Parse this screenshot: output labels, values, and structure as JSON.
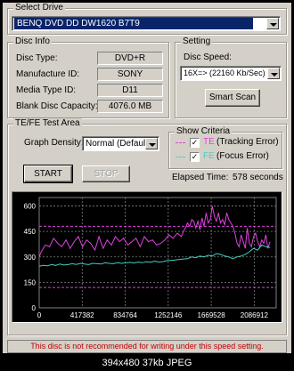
{
  "select_drive": {
    "title": "Select Drive",
    "drive": "BENQ    DVD DD DW1620   B7T9"
  },
  "disc_info": {
    "title": "Disc Info",
    "rows": [
      {
        "label": "Disc Type:",
        "value": "DVD+R"
      },
      {
        "label": "Manufacture ID:",
        "value": "SONY"
      },
      {
        "label": "Media Type ID:",
        "value": "D11"
      },
      {
        "label": "Blank Disc Capacity:",
        "value": "4076.0 MB"
      }
    ]
  },
  "setting": {
    "title": "Setting",
    "speed_label": "Disc Speed:",
    "speed_value": "16X=> (22160 Kb/Sec)",
    "smart_scan": "Smart Scan"
  },
  "tefe": {
    "title": "TE/FE Test Area",
    "density_label": "Graph Density:",
    "density_value": "Normal (Default)",
    "start": "START",
    "stop": "STOP",
    "elapsed_label": "Elapsed Time:",
    "elapsed_value": "578 seconds"
  },
  "criteria": {
    "title": "Show Criteria",
    "te": {
      "abbr": "TE",
      "text": "(Tracking Error)",
      "checked": true,
      "color": "#e040e0"
    },
    "fe": {
      "abbr": "FE",
      "text": "(Focus Error)",
      "checked": true,
      "color": "#40d0c0"
    }
  },
  "status_text": "This disc is not recommended for writing under this speed setting.",
  "caption": "394x480  37kb  JPEG",
  "chart_data": {
    "type": "line",
    "ylim": [
      0,
      650
    ],
    "yticks": [
      0,
      150,
      300,
      450,
      600
    ],
    "xlim": [
      0,
      2300000
    ],
    "xticks": [
      "0",
      "417382",
      "834764",
      "1252146",
      "1669528",
      "2086912"
    ],
    "xtick_values": [
      0,
      417382,
      834764,
      1252146,
      1669528,
      2086912
    ],
    "threshold_high": 480,
    "threshold_low": 120,
    "threshold_color": "#e040e0",
    "grid_color": "#808080",
    "series": [
      {
        "name": "TE",
        "color": "#e040e0",
        "x": [
          0,
          20000,
          60000,
          100000,
          140000,
          180000,
          220000,
          260000,
          300000,
          340000,
          380000,
          420000,
          460000,
          500000,
          540000,
          580000,
          620000,
          660000,
          700000,
          740000,
          780000,
          820000,
          860000,
          900000,
          940000,
          980000,
          1020000,
          1060000,
          1100000,
          1140000,
          1180000,
          1220000,
          1260000,
          1300000,
          1340000,
          1380000,
          1400000,
          1420000,
          1440000,
          1460000,
          1480000,
          1500000,
          1520000,
          1540000,
          1560000,
          1580000,
          1600000,
          1620000,
          1640000,
          1660000,
          1680000,
          1700000,
          1720000,
          1740000,
          1760000,
          1780000,
          1800000,
          1820000,
          1840000,
          1860000,
          1880000,
          1900000,
          1920000,
          1940000,
          1960000,
          1980000,
          2000000,
          2020000,
          2040000,
          2060000,
          2080000,
          2100000,
          2120000,
          2140000,
          2160000,
          2180000,
          2200000,
          2220000,
          2240000
        ],
        "y": [
          300,
          330,
          370,
          360,
          410,
          380,
          360,
          400,
          350,
          390,
          420,
          360,
          400,
          380,
          340,
          420,
          350,
          400,
          370,
          420,
          390,
          410,
          370,
          390,
          410,
          360,
          420,
          390,
          400,
          370,
          380,
          400,
          430,
          410,
          440,
          420,
          450,
          470,
          500,
          480,
          520,
          510,
          470,
          510,
          460,
          530,
          480,
          560,
          500,
          520,
          600,
          540,
          510,
          560,
          500,
          520,
          490,
          560,
          520,
          500,
          480,
          440,
          380,
          360,
          430,
          390,
          350,
          470,
          380,
          360,
          420,
          440,
          390,
          360,
          400,
          380,
          430,
          350,
          390
        ]
      },
      {
        "name": "FE",
        "color": "#40d0c0",
        "x": [
          0,
          40000,
          80000,
          120000,
          160000,
          200000,
          240000,
          280000,
          320000,
          360000,
          400000,
          440000,
          480000,
          520000,
          560000,
          600000,
          640000,
          680000,
          720000,
          760000,
          800000,
          840000,
          880000,
          920000,
          960000,
          1000000,
          1040000,
          1080000,
          1120000,
          1160000,
          1200000,
          1240000,
          1280000,
          1320000,
          1360000,
          1400000,
          1440000,
          1480000,
          1520000,
          1560000,
          1600000,
          1640000,
          1680000,
          1720000,
          1760000,
          1800000,
          1840000,
          1880000,
          1920000,
          1960000,
          2000000,
          2040000,
          2080000,
          2120000,
          2160000,
          2200000,
          2240000
        ],
        "y": [
          245,
          250,
          248,
          255,
          250,
          258,
          252,
          255,
          260,
          256,
          262,
          258,
          255,
          262,
          260,
          258,
          265,
          262,
          260,
          266,
          262,
          265,
          268,
          264,
          270,
          266,
          272,
          268,
          275,
          270,
          272,
          278,
          280,
          282,
          285,
          288,
          290,
          300,
          295,
          305,
          300,
          310,
          305,
          320,
          315,
          305,
          300,
          290,
          300,
          305,
          315,
          330,
          350,
          340,
          370,
          360,
          355
        ]
      }
    ]
  }
}
